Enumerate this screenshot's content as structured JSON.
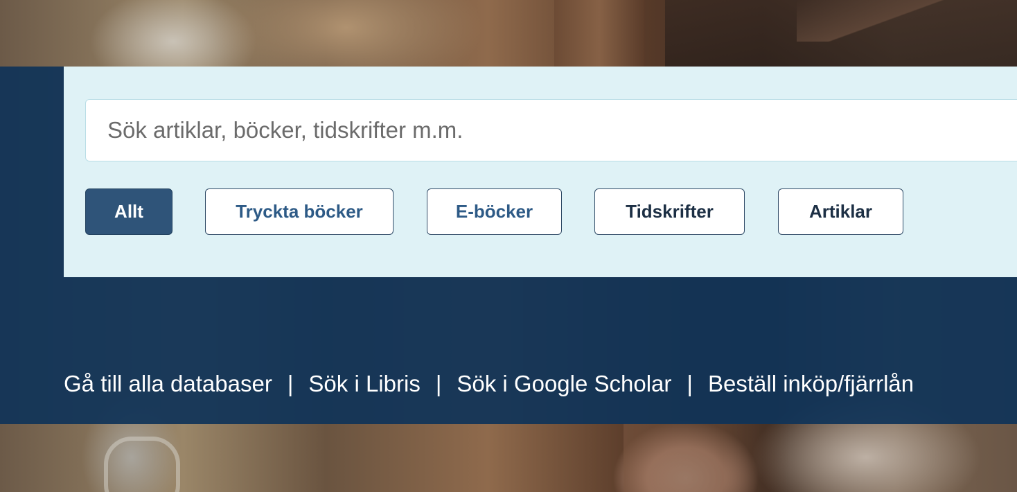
{
  "search": {
    "placeholder": "Sök artiklar, böcker, tidskrifter m.m.",
    "value": ""
  },
  "filters": [
    {
      "label": "Allt",
      "active": true
    },
    {
      "label": "Tryckta böcker",
      "active": false
    },
    {
      "label": "E-böcker",
      "active": false
    },
    {
      "label": "Tidskrifter",
      "active": false
    },
    {
      "label": "Artiklar",
      "active": false
    }
  ],
  "links": [
    {
      "label": "Gå till alla databaser"
    },
    {
      "label": "Sök i Libris"
    },
    {
      "label": "Sök i Google Scholar"
    },
    {
      "label": "Beställ inköp/fjärrlån"
    }
  ],
  "link_separator": "|",
  "colors": {
    "band": "#103458",
    "panel": "#dff2f6",
    "active_filter": "#2f5479",
    "filter_text": "#2d5a86"
  }
}
